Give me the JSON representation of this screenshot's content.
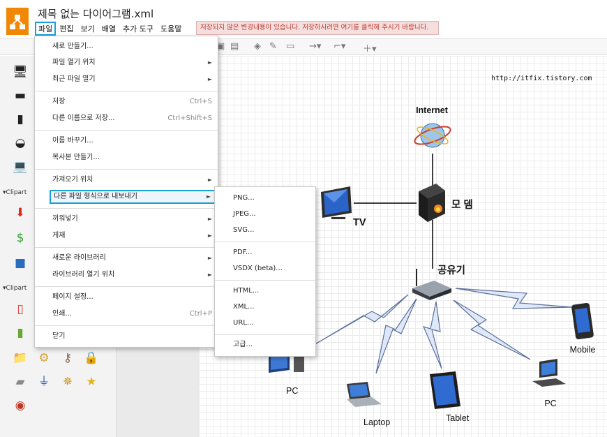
{
  "header": {
    "title": "제목 없는 다이어그램.xml",
    "menus": [
      "파일",
      "편집",
      "보기",
      "배열",
      "추가 도구",
      "도움말"
    ],
    "active_menu": "파일",
    "unsaved_notice": "저장되지 않은 변경내용이 있습니다. 저장하시려면 여기를 클릭해 주시기 바랍니다."
  },
  "sidebar": {
    "section_1": "Clipart",
    "section_2": "Clipart"
  },
  "file_menu": {
    "new": "새로 만들기...",
    "open_from": "파일 열기 위치",
    "open_recent": "최근 파일 열기",
    "save": "저장",
    "save_shortcut": "Ctrl+S",
    "save_as": "다른 이름으로 저장...",
    "save_as_shortcut": "Ctrl+Shift+S",
    "rename": "이름 바꾸기...",
    "make_copy": "복사본 만들기...",
    "import_from": "가져오기 위치",
    "export_as": "다른 파일 형식으로 내보내기",
    "embed": "끼워넣기",
    "publish": "게재",
    "new_library": "새로운 라이브러리",
    "open_library_from": "라이브러리 열기 위치",
    "page_setup": "페이지 설정...",
    "print": "인쇄...",
    "print_shortcut": "Ctrl+P",
    "close": "닫기"
  },
  "export_menu": {
    "png": "PNG...",
    "jpeg": "JPEG...",
    "svg": "SVG...",
    "pdf": "PDF...",
    "vsdx": "VSDX (beta)...",
    "html": "HTML...",
    "xml": "XML...",
    "url": "URL...",
    "advanced": "고급..."
  },
  "diagram": {
    "internet": "Internet",
    "modem": "모 뎀",
    "tv": "TV",
    "router": "공유기",
    "pc_left": "PC",
    "laptop": "Laptop",
    "tablet": "Tablet",
    "pc_right": "PC",
    "mobile": "Mobile"
  },
  "watermark": "http://itfix.tistory.com",
  "colors": {
    "accent": "#1a9fd8",
    "logo": "#f08705",
    "banner_bg": "#f5dede",
    "banner_text": "#c0392b"
  }
}
